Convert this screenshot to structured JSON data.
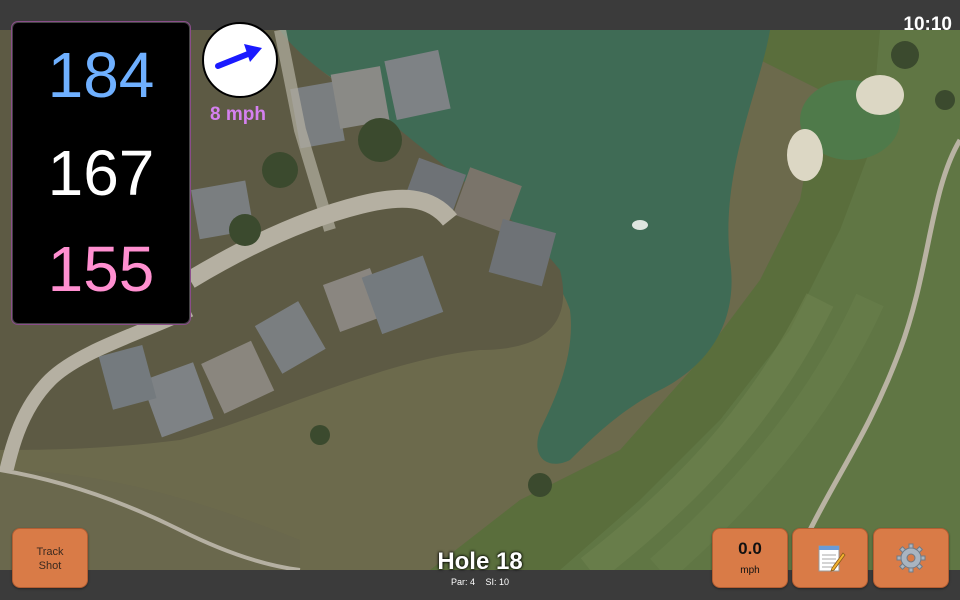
{
  "status_bar": {
    "time": "10:10"
  },
  "distances": {
    "back": "184",
    "middle": "167",
    "front": "155"
  },
  "wind": {
    "speed": "8 mph",
    "direction_icon": "wind-arrow-icon"
  },
  "track_shot": {
    "label_line1": "Track",
    "label_line2": "Shot"
  },
  "hole": {
    "title": "Hole 18",
    "par": "Par: 4",
    "si": "SI: 10"
  },
  "speed": {
    "value": "0.0",
    "unit": "mph"
  },
  "icons": {
    "notes": "notepad-icon",
    "settings": "gear-icon"
  },
  "colors": {
    "back_distance": "#6fb0ff",
    "middle_distance": "#ffffff",
    "front_distance": "#ff8fd0",
    "wind_text": "#d580f0",
    "button": "#d97b47",
    "water": "#3f6b55"
  }
}
